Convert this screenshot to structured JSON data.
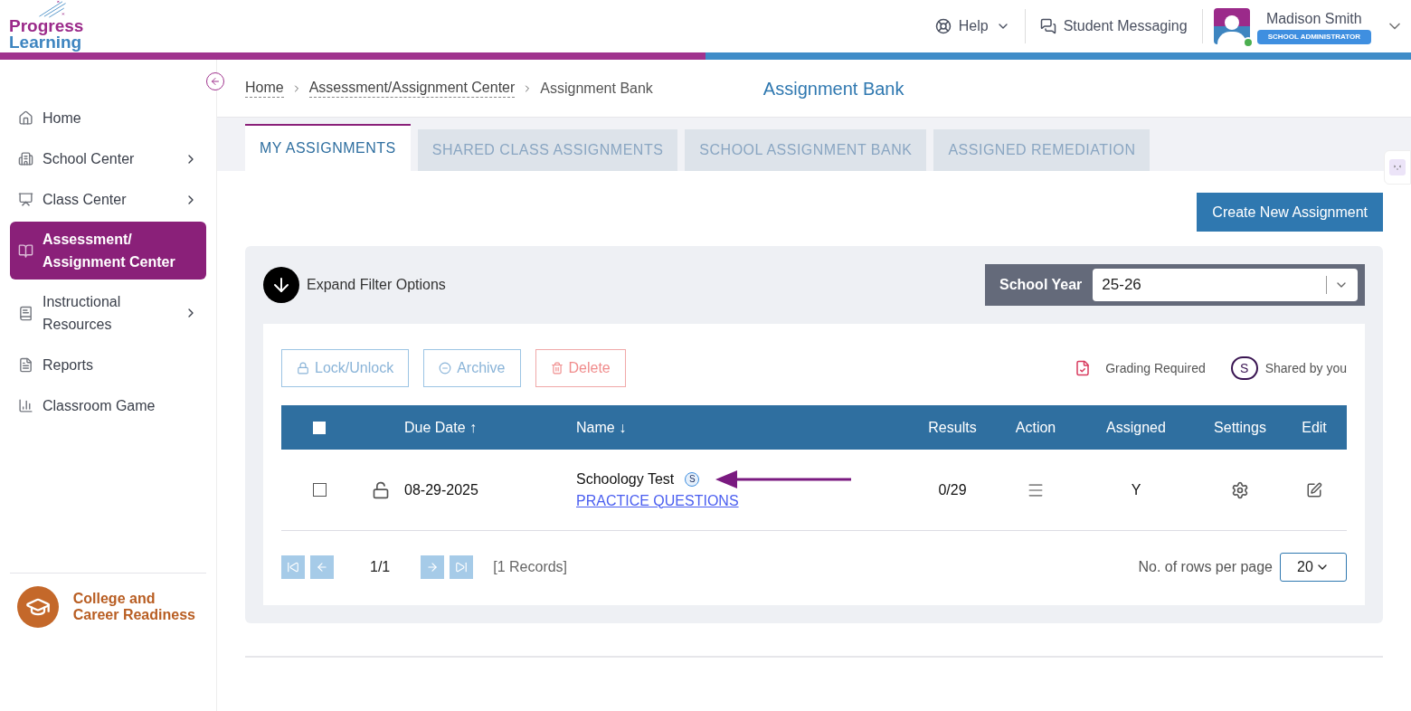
{
  "header": {
    "logo_top": "Progress",
    "logo_bottom": "Learning",
    "help": "Help",
    "messaging": "Student Messaging",
    "user": {
      "name": "Madison Smith",
      "role": "SCHOOL ADMINISTRATOR",
      "online": true
    }
  },
  "sidebar": {
    "items": [
      {
        "label": "Home",
        "has_submenu": false,
        "selected": false
      },
      {
        "label": "School Center",
        "has_submenu": true,
        "selected": false
      },
      {
        "label": "Class Center",
        "has_submenu": true,
        "selected": false
      },
      {
        "label": "Assessment/ Assignment Center",
        "has_submenu": false,
        "selected": true
      },
      {
        "label": "Instructional Resources",
        "has_submenu": true,
        "selected": false
      },
      {
        "label": "Reports",
        "has_submenu": false,
        "selected": false
      },
      {
        "label": "Classroom Game",
        "has_submenu": false,
        "selected": false
      }
    ],
    "footer": "College and Career Readiness"
  },
  "breadcrumb": [
    "Home",
    "Assessment/Assignment Center",
    "Assignment Bank"
  ],
  "page_title": "Assignment Bank",
  "tabs": [
    {
      "label": "MY ASSIGNMENTS",
      "selected": true
    },
    {
      "label": "SHARED CLASS ASSIGNMENTS",
      "selected": false
    },
    {
      "label": "SCHOOL ASSIGNMENT BANK",
      "selected": false
    },
    {
      "label": "ASSIGNED REMEDIATION",
      "selected": false
    }
  ],
  "create_button": "Create New Assignment",
  "filter": {
    "expand": "Expand Filter Options",
    "school_year_label": "School Year",
    "school_year": "25-26"
  },
  "actions": [
    {
      "label": "Lock/Unlock",
      "kind": "lock",
      "disabled": true
    },
    {
      "label": "Archive",
      "kind": "archive",
      "disabled": true
    },
    {
      "label": "Delete",
      "kind": "delete",
      "disabled": true
    }
  ],
  "legend": {
    "grading": "Grading Required",
    "shared_mark": "S",
    "shared": "Shared by you"
  },
  "table": {
    "select_all_checked": false,
    "columns": [
      {
        "label": "Due Date",
        "sort_arrow": "↑"
      },
      {
        "label": "Name",
        "sort_arrow": "↓"
      },
      {
        "label": "Results"
      },
      {
        "label": "Action"
      },
      {
        "label": "Assigned"
      },
      {
        "label": "Settings"
      },
      {
        "label": "Edit"
      }
    ],
    "rows": [
      {
        "checked": false,
        "locked": false,
        "due_date": "08-29-2025",
        "name": "Schoology Test",
        "shared_mark": "S",
        "link": "PRACTICE QUESTIONS",
        "results": "0/29",
        "assigned": "Y"
      }
    ]
  },
  "pagination": {
    "disabled": true,
    "page": "1/1",
    "records": "[1 Records]",
    "rows_label": "No. of rows per page",
    "rows_per_page": "20"
  }
}
